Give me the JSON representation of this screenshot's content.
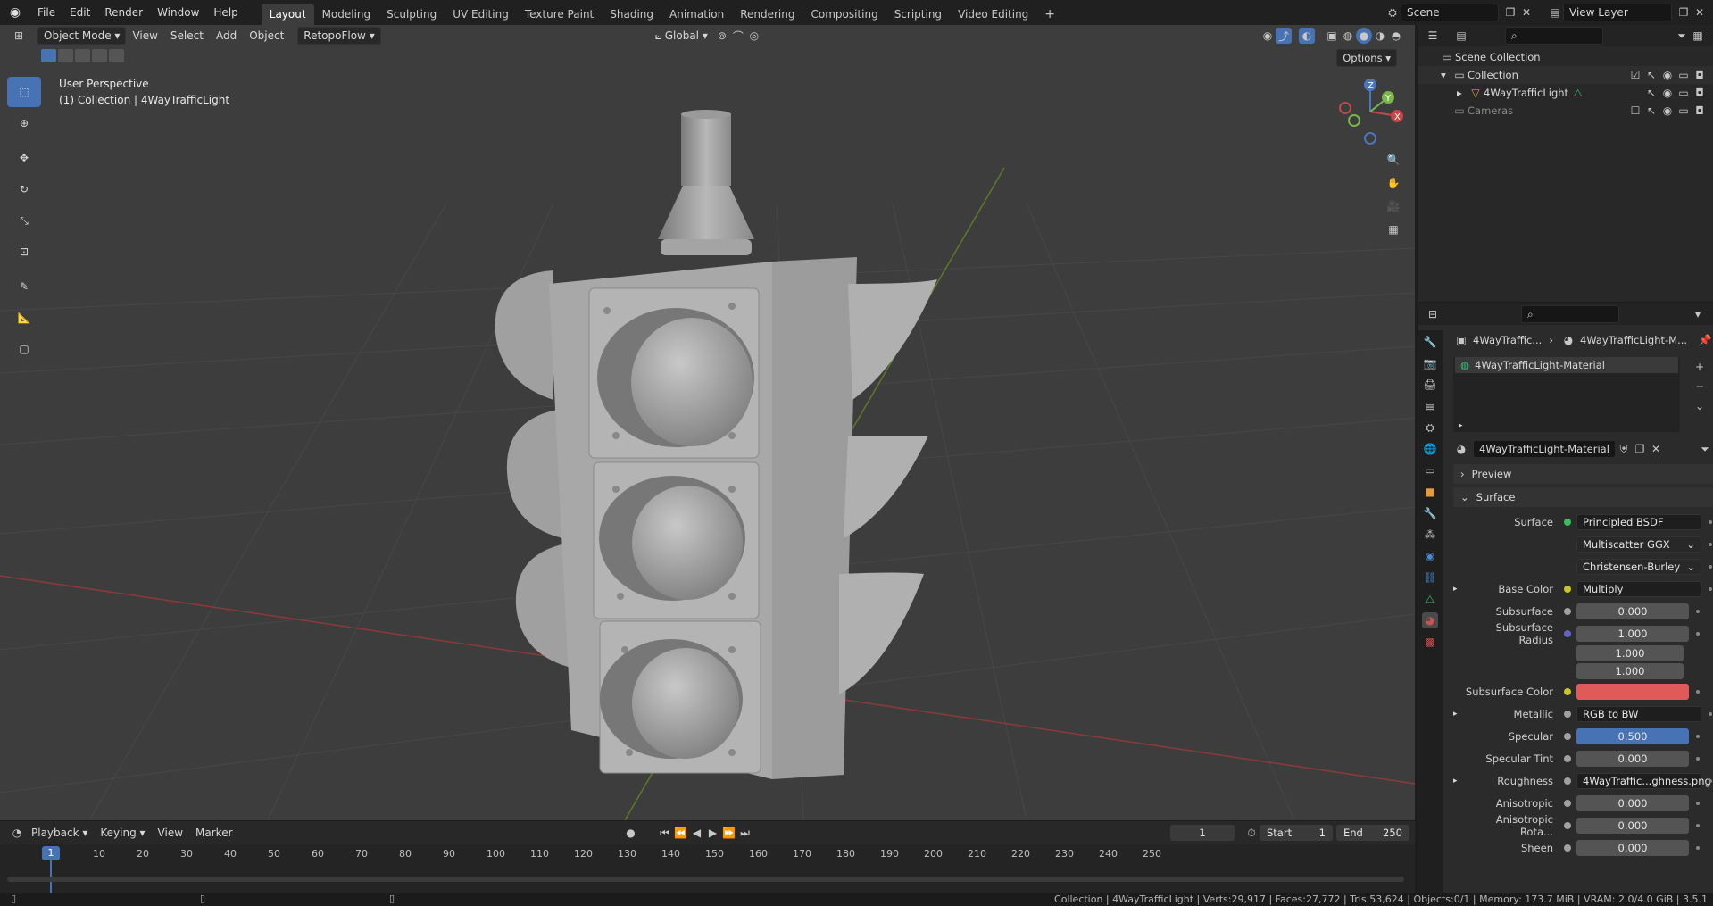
{
  "app": {
    "logo": "blender-logo"
  },
  "menu": [
    "File",
    "Edit",
    "Render",
    "Window",
    "Help"
  ],
  "workspaces": [
    "Layout",
    "Modeling",
    "Sculpting",
    "UV Editing",
    "Texture Paint",
    "Shading",
    "Animation",
    "Rendering",
    "Compositing",
    "Scripting",
    "Video Editing"
  ],
  "scene_name": "Scene",
  "view_layer": "View Layer",
  "viewport_header": {
    "mode": "Object Mode",
    "view": "View",
    "select": "Select",
    "add": "Add",
    "object": "Object",
    "addon": "RetopoFlow",
    "transform": "Global",
    "options": "Options"
  },
  "viewport_overlay": {
    "perspective": "User Perspective",
    "collection": "(1) Collection | 4WayTrafficLight"
  },
  "gizmo": {
    "x": "X",
    "y": "Y",
    "z": "Z"
  },
  "outliner": {
    "root": "Scene Collection",
    "collection": "Collection",
    "object": "4WayTrafficLight",
    "cameras": "Cameras"
  },
  "props": {
    "breadcrumb_obj": "4WayTraffic...",
    "breadcrumb_mat": "4WayTrafficLight-M...",
    "slot": "4WayTrafficLight-Material",
    "material": "4WayTrafficLight-Material",
    "preview": "Preview",
    "surface_panel": "Surface",
    "rows": [
      {
        "label": "Surface",
        "node": "Principled BSDF",
        "socket": "#39c05b"
      },
      {
        "label": "",
        "dropdown": "Multiscatter GGX"
      },
      {
        "label": "",
        "dropdown": "Christensen-Burley"
      },
      {
        "label": "Base Color",
        "node": "Multiply",
        "socket": "#c7c729",
        "expand": true
      },
      {
        "label": "Subsurface",
        "value": "0.000",
        "socket": "#a1a1a1"
      },
      {
        "label": "Subsurface Radius",
        "value": "1.000",
        "socket": "#6363c7"
      },
      {
        "label": "",
        "value": "1.000"
      },
      {
        "label": "",
        "value": "1.000"
      },
      {
        "label": "Subsurface Color",
        "color": "#e05a5a",
        "socket": "#c7c729"
      },
      {
        "label": "Metallic",
        "node": "RGB to BW",
        "socket": "#a1a1a1",
        "expand": true
      },
      {
        "label": "Specular",
        "value": "0.500",
        "socket": "#a1a1a1",
        "blue": true
      },
      {
        "label": "Specular Tint",
        "value": "0.000",
        "socket": "#a1a1a1"
      },
      {
        "label": "Roughness",
        "node": "4WayTraffic...ghness.png",
        "socket": "#a1a1a1",
        "expand": true
      },
      {
        "label": "Anisotropic",
        "value": "0.000",
        "socket": "#a1a1a1"
      },
      {
        "label": "Anisotropic Rota...",
        "value": "0.000",
        "socket": "#a1a1a1"
      },
      {
        "label": "Sheen",
        "value": "0.000",
        "socket": "#a1a1a1"
      }
    ]
  },
  "timeline": {
    "playback": "Playback",
    "keying": "Keying",
    "view": "View",
    "marker": "Marker",
    "current": "1",
    "start_label": "Start",
    "start": "1",
    "end_label": "End",
    "end": "250",
    "ticks": [
      "10",
      "20",
      "30",
      "40",
      "50",
      "60",
      "70",
      "80",
      "90",
      "100",
      "110",
      "120",
      "130",
      "140",
      "150",
      "160",
      "170",
      "180",
      "190",
      "200",
      "210",
      "220",
      "230",
      "240",
      "250"
    ]
  },
  "status": "Collection | 4WayTrafficLight | Verts:29,917 | Faces:27,772 | Tris:53,624 | Objects:0/1 | Memory: 173.7 MiB | VRAM: 2.0/4.0 GiB | 3.5.1",
  "colors": {
    "accent": "#4772b3",
    "subsurface_color": "#e05a5a"
  }
}
